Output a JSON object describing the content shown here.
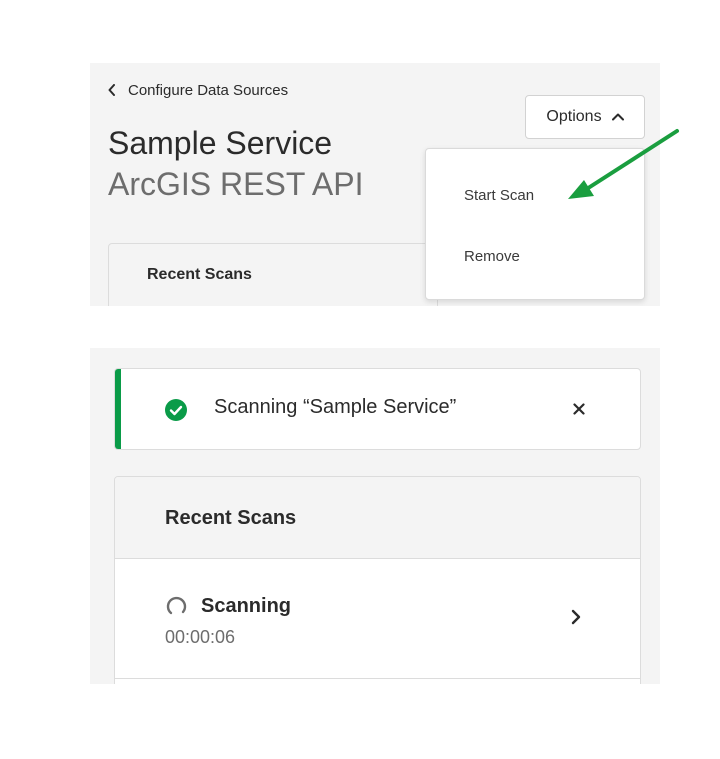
{
  "top": {
    "back_label": "Configure Data Sources",
    "title": "Sample Service",
    "subtitle": "ArcGIS REST API",
    "options_label": "Options",
    "menu": [
      "Start Scan",
      "Remove"
    ],
    "recent_scans_title": "Recent Scans",
    "annotation_arrow_color": "#1a9e3f"
  },
  "bottom": {
    "toast_message": "Scanning “Sample Service”",
    "toast_accent_color": "#0a9b48",
    "recent_scans_title": "Recent Scans",
    "scan": {
      "status": "Scanning",
      "elapsed": "00:00:06"
    }
  },
  "icons": {
    "back": "chevron-left-icon",
    "options": "chevron-up-icon",
    "toast": "check-circle-icon",
    "close": "close-icon",
    "status": "spinner-icon",
    "row": "chevron-right-icon"
  }
}
